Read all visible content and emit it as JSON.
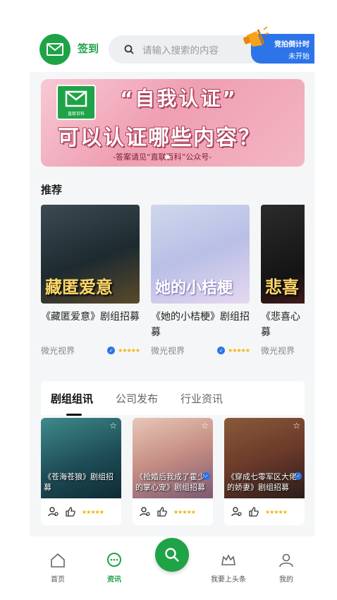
{
  "header": {
    "checkin_label": "签到",
    "search_placeholder": "请输入搜索的内容",
    "countdown_title": "竞拍倒计时",
    "countdown_status": "未开始"
  },
  "banner": {
    "logo_text": "直联百科",
    "line1": "“自我认证”",
    "line2": "可以认证哪些内容？",
    "line3": "-答案请见“直联百科”公众号-"
  },
  "recommend": {
    "title": "推荐",
    "items": [
      {
        "image_text": "藏匿爱意",
        "name": "《藏匿爱意》剧组招募",
        "author": "微光视界"
      },
      {
        "image_text": "她的小桔梗",
        "name": "《她的小桔梗》剧组招募",
        "author": "微光视界"
      },
      {
        "image_text": "悲喜",
        "name": "《悲喜心",
        "name_line2": "募",
        "author": "微光视界"
      }
    ]
  },
  "tabs": [
    "剧组组讯",
    "公司发布",
    "行业资讯"
  ],
  "grid": [
    {
      "caption": "《苍海苍狼》剧组招募"
    },
    {
      "caption": "《抢婚后我成了霍少的掌心宠》剧组招募"
    },
    {
      "caption": "《穿成七零军区大佬的娇妻》剧组招募"
    }
  ],
  "nav": {
    "home": "首页",
    "news": "资讯",
    "headline": "我要上头条",
    "mine": "我的"
  },
  "colors": {
    "brand": "#1fa347",
    "accent": "#2d74e8",
    "star": "#f5b301"
  }
}
